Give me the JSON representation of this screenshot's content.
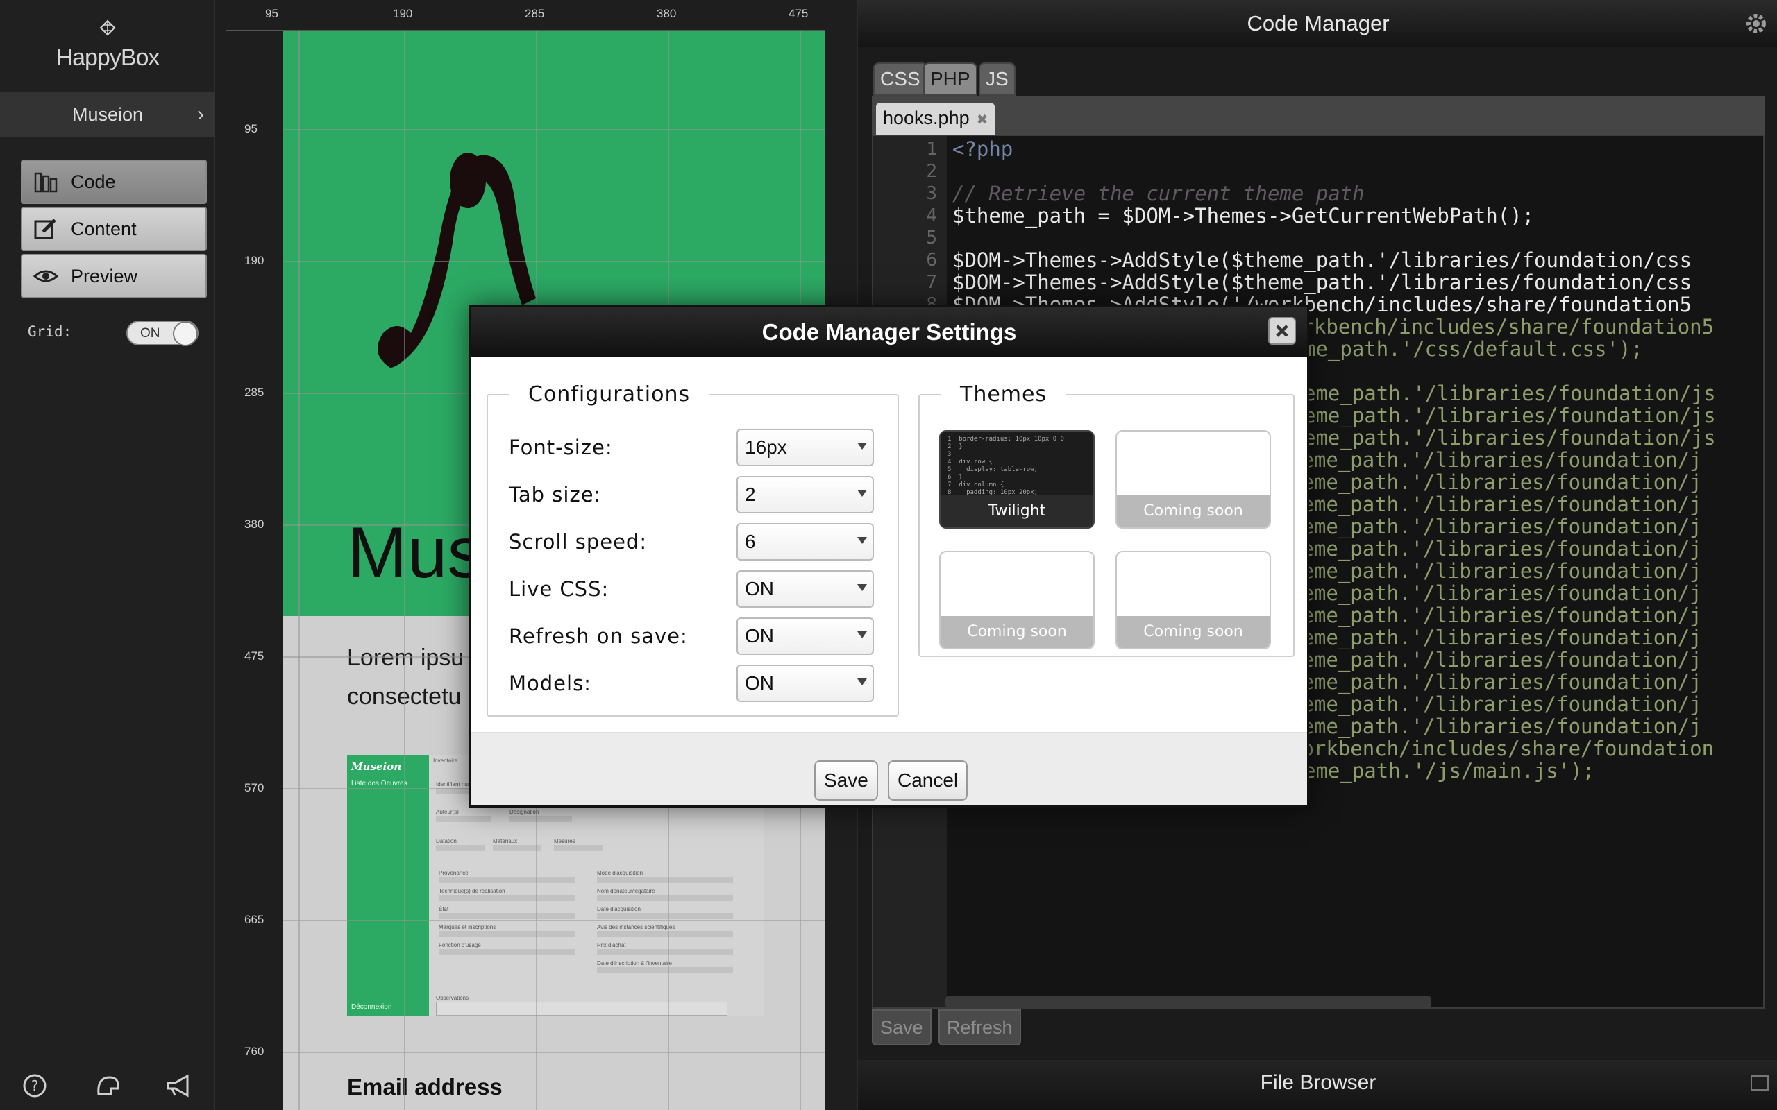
{
  "sidebar": {
    "logo_text": "HappyBox",
    "project_name": "Museion",
    "modes": [
      {
        "label": "Code",
        "icon": "code-icon"
      },
      {
        "label": "Content",
        "icon": "edit-icon"
      },
      {
        "label": "Preview",
        "icon": "eye-icon"
      }
    ],
    "grid_label": "Grid:",
    "grid_toggle": "ON",
    "footer_icons": [
      "help-icon",
      "helmet-icon",
      "megaphone-icon"
    ]
  },
  "preview": {
    "ruler_top": [
      "95",
      "190",
      "285",
      "380",
      "475"
    ],
    "ruler_left": [
      "95",
      "190",
      "285",
      "380",
      "475",
      "570",
      "665",
      "760"
    ],
    "hero_title": "Mus",
    "lorem_line1": "Lorem ipsu",
    "lorem_line2": "consectetu",
    "mock_logo": "Museion",
    "mock_nav": "Liste des Oeuvres",
    "mock_logout": "Déconnexion",
    "mock_form": {
      "section": "Inventaire",
      "fields_left": [
        "Identifiant numérique",
        "Auteur(s)",
        "Datation",
        "Provenance",
        "Technique(s) de réalisation",
        "État",
        "Marques et inscriptions",
        "Fonction d'usage",
        "Observations"
      ],
      "fields_mid": [
        "Désignation",
        "Matériaux",
        "Mesures"
      ],
      "fields_right": [
        "Mode d'acquisition",
        "Nom donateur/légataire",
        "Date d'acquisition",
        "Avis des instances scientifiques",
        "Prix d'achat",
        "Date d'inscription à l'inventaire"
      ]
    },
    "email_label": "Email address",
    "brand_green": "#2caa64"
  },
  "code_manager": {
    "title": "Code Manager",
    "tabs": [
      "CSS",
      "PHP",
      "JS"
    ],
    "active_tab": "PHP",
    "file": "hooks.php",
    "line_numbers": [
      "1",
      "2",
      "3",
      "4",
      "5",
      "6",
      "7",
      "8"
    ],
    "code_lines": [
      "<?php",
      "",
      "// Retrieve the current theme path",
      "$theme_path = $DOM->Themes->GetCurrentWebPath();",
      "",
      "$DOM->Themes->AddStyle($theme_path.'/libraries/foundation/css",
      "$DOM->Themes->AddStyle($theme_path.'/libraries/foundation/css",
      "$DOM->Themes->AddStyle('/workbench/includes/share/foundation5"
    ],
    "code_right_fragments": [
      "orkbench/includes/share/foundation5",
      "me_path.'/css/default.css');",
      "",
      "eme_path.'/libraries/foundation/js",
      "eme_path.'/libraries/foundation/js",
      "eme_path.'/libraries/foundation/js",
      "heme_path.'/libraries/foundation/j",
      "heme_path.'/libraries/foundation/j",
      "heme_path.'/libraries/foundation/j",
      "heme_path.'/libraries/foundation/j",
      "heme_path.'/libraries/foundation/j",
      "heme_path.'/libraries/foundation/j",
      "heme_path.'/libraries/foundation/j",
      "heme_path.'/libraries/foundation/j",
      "heme_path.'/libraries/foundation/j",
      "heme_path.'/libraries/foundation/j",
      "heme_path.'/libraries/foundation/j",
      "heme_path.'/libraries/foundation/j",
      "heme_path.'/libraries/foundation/j",
      "workbench/includes/share/foundation",
      "eme_path.'/js/main.js');"
    ],
    "save_label": "Save",
    "refresh_label": "Refresh",
    "file_browser": "File Browser"
  },
  "modal": {
    "title": "Code Manager Settings",
    "config_legend": "Configurations",
    "themes_legend": "Themes",
    "configs": [
      {
        "label": "Font-size:",
        "value": "16px"
      },
      {
        "label": "Tab size:",
        "value": "2"
      },
      {
        "label": "Scroll speed:",
        "value": "6"
      },
      {
        "label": "Live CSS:",
        "value": "ON"
      },
      {
        "label": "Refresh on save:",
        "value": "ON"
      },
      {
        "label": "Models:",
        "value": "ON"
      }
    ],
    "themes": [
      "Twilight",
      "Coming soon",
      "Coming soon",
      "Coming soon"
    ],
    "save_label": "Save",
    "cancel_label": "Cancel"
  }
}
